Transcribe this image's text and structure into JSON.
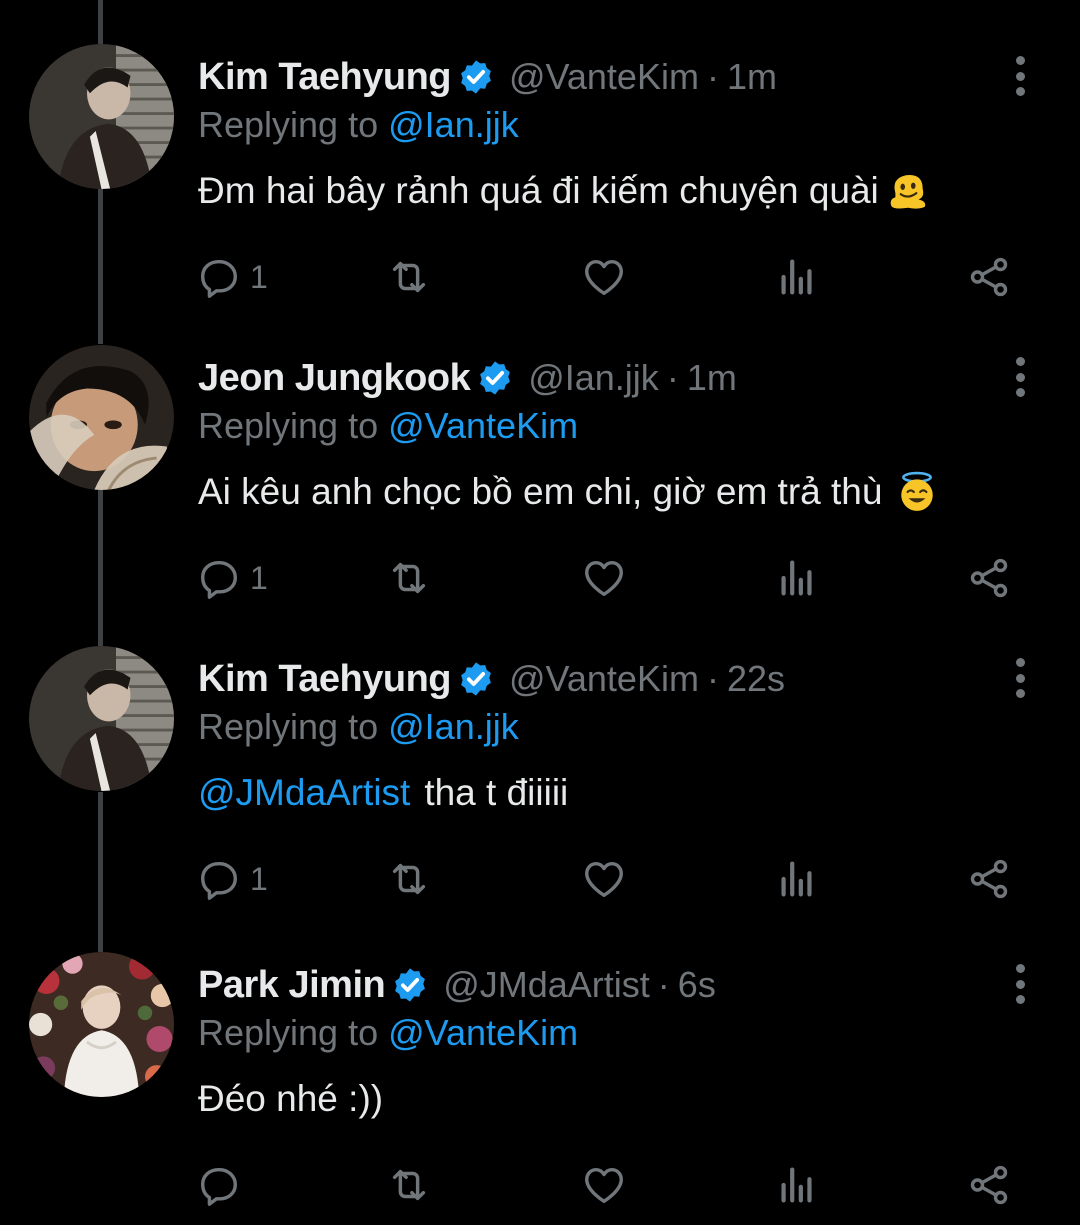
{
  "colors": {
    "background": "#000000",
    "text": "#e7e9ea",
    "muted": "#71767b",
    "accent": "#1d9bf0",
    "thread_line": "#3e4144"
  },
  "tweets": [
    {
      "display_name": "Kim Taehyung",
      "verified": true,
      "handle": "@VanteKim",
      "separator": "·",
      "time": "1m",
      "reply_prefix": "Replying to",
      "reply_to": "@Ian.jjk",
      "mention": "",
      "text": "Đm hai bây rảnh quá đi kiếm chuyện quài",
      "emoji": "melting-face-emoji",
      "reply_count": "1",
      "avatar": "avatar-photo-man-by-window"
    },
    {
      "display_name": "Jeon Jungkook",
      "verified": true,
      "handle": "@Ian.jjk",
      "separator": "·",
      "time": "1m",
      "reply_prefix": "Replying to",
      "reply_to": "@VanteKim",
      "mention": "",
      "text": "Ai kêu anh chọc bồ em chi, giờ em trả thù",
      "emoji": "smiling-face-with-halo-emoji",
      "reply_count": "1",
      "avatar": "avatar-photo-face-with-leaves"
    },
    {
      "display_name": "Kim Taehyung",
      "verified": true,
      "handle": "@VanteKim",
      "separator": "·",
      "time": "22s",
      "reply_prefix": "Replying to",
      "reply_to": "@Ian.jjk",
      "mention": "@JMdaArtist",
      "text": "tha t điiiii",
      "emoji": "",
      "reply_count": "1",
      "avatar": "avatar-photo-man-by-window"
    },
    {
      "display_name": "Park Jimin",
      "verified": true,
      "handle": "@JMdaArtist",
      "separator": "·",
      "time": "6s",
      "reply_prefix": "Replying to",
      "reply_to": "@VanteKim",
      "mention": "",
      "text": "Đéo nhé :))",
      "emoji": "",
      "reply_count": "",
      "avatar": "avatar-photo-flowers"
    }
  ]
}
